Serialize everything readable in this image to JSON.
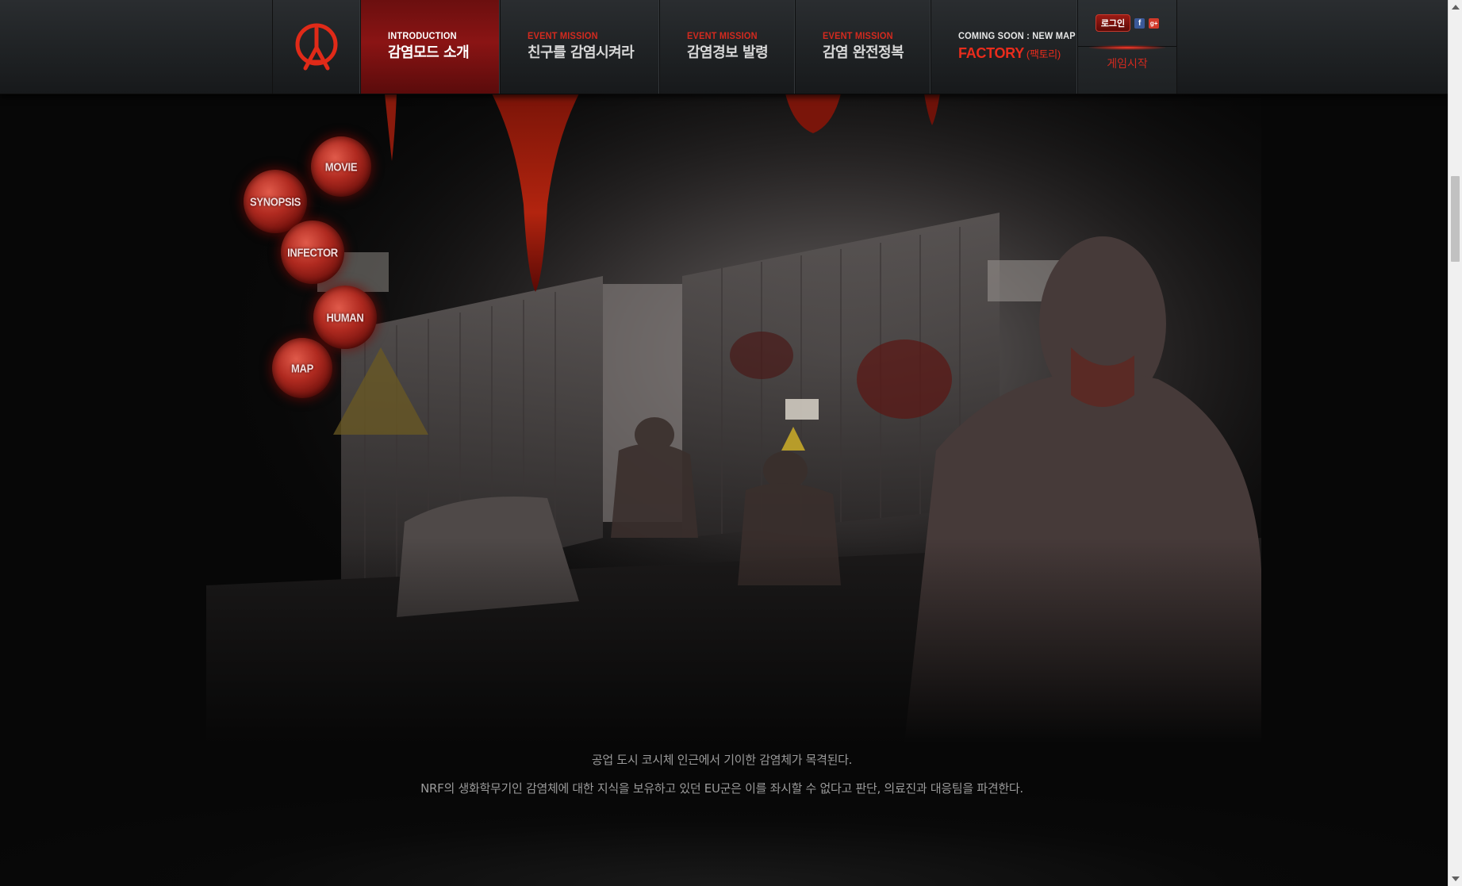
{
  "nav": {
    "items": [
      {
        "sub": "INTRODUCTION",
        "main": "감염모드 소개",
        "active": true
      },
      {
        "sub": "EVENT MISSION",
        "main": "친구를 감염시켜라",
        "active": false
      },
      {
        "sub": "EVENT MISSION",
        "main": "감염경보 발령",
        "active": false
      },
      {
        "sub": "EVENT MISSION",
        "main": "감염 완전정복",
        "active": false
      }
    ],
    "soon": {
      "sub": "COMING SOON : NEW MAP",
      "main": "FACTORY",
      "main_kr": "(팩토리)"
    },
    "account": {
      "login_label": "로그인",
      "facebook_icon": "f",
      "gplus_icon": "g+",
      "start_label": "게임시작"
    }
  },
  "side_menu": {
    "items": [
      "MOVIE",
      "SYNOPSIS",
      "INFECTOR",
      "HUMAN",
      "MAP"
    ]
  },
  "description": {
    "line1": "공업 도시 코시체 인근에서 기이한 감염체가 목격된다.",
    "line2": "NRF의 생화학무기인 감염체에 대한 지식을 보유하고 있던 EU군은 이를 좌시할 수 없다고 판단, 의료진과 대응팀을 파견한다."
  },
  "colors": {
    "accent": "#d32a1f",
    "active_tab": "#8a1414",
    "topbar": "#1f2224"
  }
}
